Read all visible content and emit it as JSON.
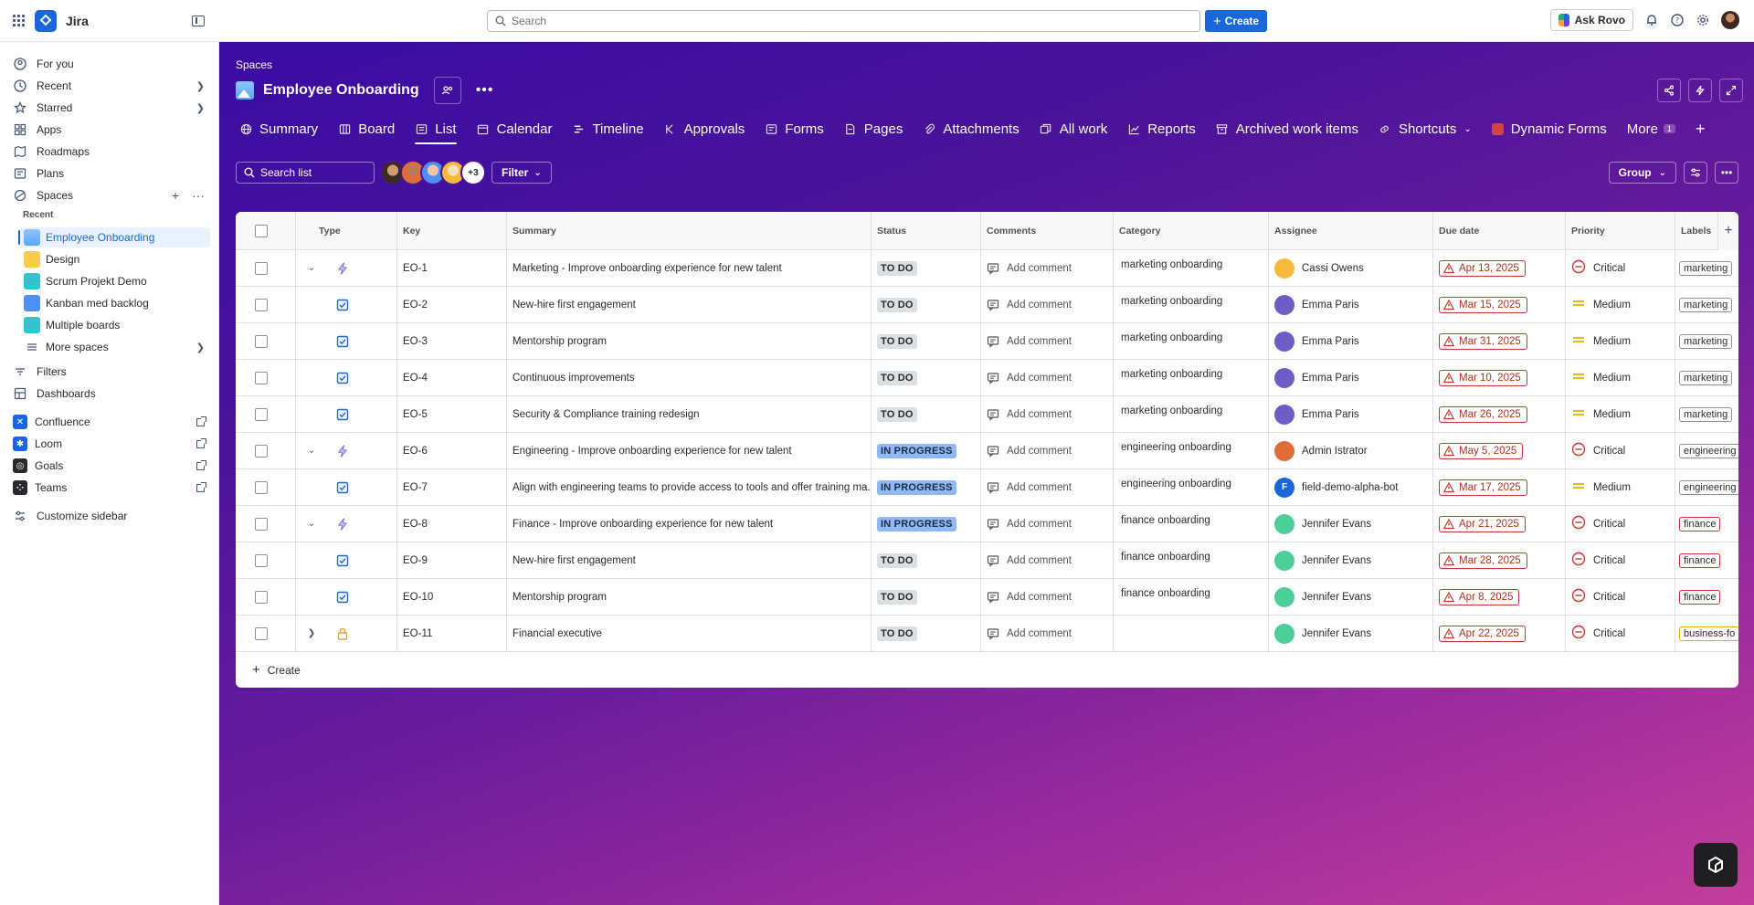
{
  "topbar": {
    "app_name": "Jira",
    "search_placeholder": "Search",
    "create_label": "Create",
    "ask_rovo_label": "Ask Rovo"
  },
  "sidebar": {
    "nav": [
      {
        "label": "For you",
        "icon": "user-circle-icon"
      },
      {
        "label": "Recent",
        "icon": "clock-icon"
      },
      {
        "label": "Starred",
        "icon": "star-icon"
      },
      {
        "label": "Apps",
        "icon": "apps-grid-icon"
      },
      {
        "label": "Roadmaps",
        "icon": "roadmap-icon"
      },
      {
        "label": "Plans",
        "icon": "plans-icon"
      },
      {
        "label": "Spaces",
        "icon": "spaces-icon"
      }
    ],
    "recent_heading": "Recent",
    "spaces": [
      {
        "label": "Employee Onboarding",
        "color": "#5aa6f5"
      },
      {
        "label": "Design",
        "color": "#f5cd47"
      },
      {
        "label": "Scrum Projekt Demo",
        "color": "#2ec5ce"
      },
      {
        "label": "Kanban med backlog",
        "color": "#4d8ff5"
      },
      {
        "label": "Multiple boards",
        "color": "#2ec5ce"
      }
    ],
    "more_spaces": "More spaces",
    "filters": "Filters",
    "dashboards": "Dashboards",
    "apps": [
      {
        "label": "Confluence",
        "color": "#1868db"
      },
      {
        "label": "Loom",
        "color": "#1868db"
      },
      {
        "label": "Goals",
        "color": "#292a2e"
      },
      {
        "label": "Teams",
        "color": "#292a2e"
      }
    ],
    "customize": "Customize sidebar"
  },
  "header": {
    "breadcrumb": "Spaces",
    "project_title": "Employee Onboarding"
  },
  "tabs": [
    {
      "label": "Summary",
      "icon": "globe-icon"
    },
    {
      "label": "Board",
      "icon": "board-icon"
    },
    {
      "label": "List",
      "icon": "list-icon",
      "active": true
    },
    {
      "label": "Calendar",
      "icon": "calendar-icon"
    },
    {
      "label": "Timeline",
      "icon": "timeline-icon"
    },
    {
      "label": "Approvals",
      "icon": "approvals-icon"
    },
    {
      "label": "Forms",
      "icon": "forms-icon"
    },
    {
      "label": "Pages",
      "icon": "pages-icon"
    },
    {
      "label": "Attachments",
      "icon": "paperclip-icon"
    },
    {
      "label": "All work",
      "icon": "stack-icon"
    },
    {
      "label": "Reports",
      "icon": "chart-line-icon"
    },
    {
      "label": "Archived work items",
      "icon": "archive-icon"
    },
    {
      "label": "Shortcuts",
      "icon": "link-icon"
    },
    {
      "label": "Dynamic Forms",
      "icon": "dynamic-forms-icon"
    }
  ],
  "more_tab": {
    "label": "More",
    "badge": "1"
  },
  "toolbar": {
    "search_placeholder": "Search list",
    "avatars_more": "+3",
    "filter_label": "Filter",
    "group_label": "Group"
  },
  "columns": [
    "Type",
    "Key",
    "Summary",
    "Status",
    "Comments",
    "Category",
    "Assignee",
    "Due date",
    "Priority",
    "Labels"
  ],
  "rows": [
    {
      "key": "EO-1",
      "type": "epic",
      "expander": "down",
      "summary": "Marketing - Improve onboarding experience for new talent",
      "status": "TO DO",
      "status_kind": "todo",
      "comment": "Add comment",
      "category": "marketing onboarding",
      "assignee": "Cassi Owens",
      "assignee_color": "#f5b93b",
      "due": "Apr 13, 2025",
      "priority": "Critical",
      "label": "marketing",
      "label_kind": "grey"
    },
    {
      "key": "EO-2",
      "type": "task",
      "expander": "",
      "summary": "New-hire first engagement",
      "status": "TO DO",
      "status_kind": "todo",
      "comment": "Add comment",
      "category": "marketing onboarding",
      "assignee": "Emma Paris",
      "assignee_color": "#6e5dc6",
      "due": "Mar 15, 2025",
      "priority": "Medium",
      "label": "marketing",
      "label_kind": "grey"
    },
    {
      "key": "EO-3",
      "type": "task",
      "expander": "",
      "summary": "Mentorship program",
      "status": "TO DO",
      "status_kind": "todo",
      "comment": "Add comment",
      "category": "marketing onboarding",
      "assignee": "Emma Paris",
      "assignee_color": "#6e5dc6",
      "due": "Mar 31, 2025",
      "priority": "Medium",
      "label": "marketing",
      "label_kind": "grey"
    },
    {
      "key": "EO-4",
      "type": "task",
      "expander": "",
      "summary": "Continuous improvements",
      "status": "TO DO",
      "status_kind": "todo",
      "comment": "Add comment",
      "category": "marketing onboarding",
      "assignee": "Emma Paris",
      "assignee_color": "#6e5dc6",
      "due": "Mar 10, 2025",
      "priority": "Medium",
      "label": "marketing",
      "label_kind": "grey"
    },
    {
      "key": "EO-5",
      "type": "task",
      "expander": "",
      "summary": "Security & Compliance training redesign",
      "status": "TO DO",
      "status_kind": "todo",
      "comment": "Add comment",
      "category": "marketing onboarding",
      "assignee": "Emma Paris",
      "assignee_color": "#6e5dc6",
      "due": "Mar 26, 2025",
      "priority": "Medium",
      "label": "marketing",
      "label_kind": "grey"
    },
    {
      "key": "EO-6",
      "type": "epic",
      "expander": "down",
      "summary": "Engineering - Improve onboarding experience for new talent",
      "status": "IN PROGRESS",
      "status_kind": "prog",
      "comment": "Add comment",
      "category": "engineering onboarding",
      "assignee": "Admin Istrator",
      "assignee_color": "#e06c3a",
      "due": "May 5, 2025",
      "priority": "Critical",
      "label": "engineering",
      "label_kind": "grey"
    },
    {
      "key": "EO-7",
      "type": "task",
      "expander": "",
      "summary": "Align with engineering teams to provide access to tools and offer training ma...",
      "status": "IN PROGRESS",
      "status_kind": "prog",
      "comment": "Add comment",
      "category": "engineering onboarding",
      "assignee": "field-demo-alpha-bot",
      "assignee_color": "#1868db",
      "assignee_initial": "F",
      "due": "Mar 17, 2025",
      "priority": "Medium",
      "label": "engineering",
      "label_kind": "grey"
    },
    {
      "key": "EO-8",
      "type": "epic",
      "expander": "down",
      "summary": "Finance - Improve onboarding experience for new talent",
      "status": "IN PROGRESS",
      "status_kind": "prog",
      "comment": "Add comment",
      "category": "finance onboarding",
      "assignee": "Jennifer Evans",
      "assignee_color": "#4bce97",
      "due": "Apr 21, 2025",
      "priority": "Critical",
      "label": "finance",
      "label_kind": "red"
    },
    {
      "key": "EO-9",
      "type": "task",
      "expander": "",
      "summary": "New-hire first engagement",
      "status": "TO DO",
      "status_kind": "todo",
      "comment": "Add comment",
      "category": "finance onboarding",
      "assignee": "Jennifer Evans",
      "assignee_color": "#4bce97",
      "due": "Mar 28, 2025",
      "priority": "Critical",
      "label": "finance",
      "label_kind": "red"
    },
    {
      "key": "EO-10",
      "type": "task",
      "expander": "",
      "summary": "Mentorship program",
      "status": "TO DO",
      "status_kind": "todo",
      "comment": "Add comment",
      "category": "finance onboarding",
      "assignee": "Jennifer Evans",
      "assignee_color": "#4bce97",
      "due": "Apr 8, 2025",
      "priority": "Critical",
      "label": "finance",
      "label_kind": "red"
    },
    {
      "key": "EO-11",
      "type": "lock",
      "expander": "right",
      "summary": "Financial executive",
      "status": "TO DO",
      "status_kind": "todo",
      "comment": "Add comment",
      "category": "",
      "assignee": "Jennifer Evans",
      "assignee_color": "#4bce97",
      "due": "Apr 22, 2025",
      "priority": "Critical",
      "label": "business-fo",
      "label_kind": "yel"
    }
  ],
  "create_row_label": "Create",
  "colors": {
    "brand": "#1868db",
    "critical": "#c9372c",
    "medium": "#e2b203",
    "gradient_start": "#3a0ca3",
    "gradient_end": "#c43e9c"
  }
}
